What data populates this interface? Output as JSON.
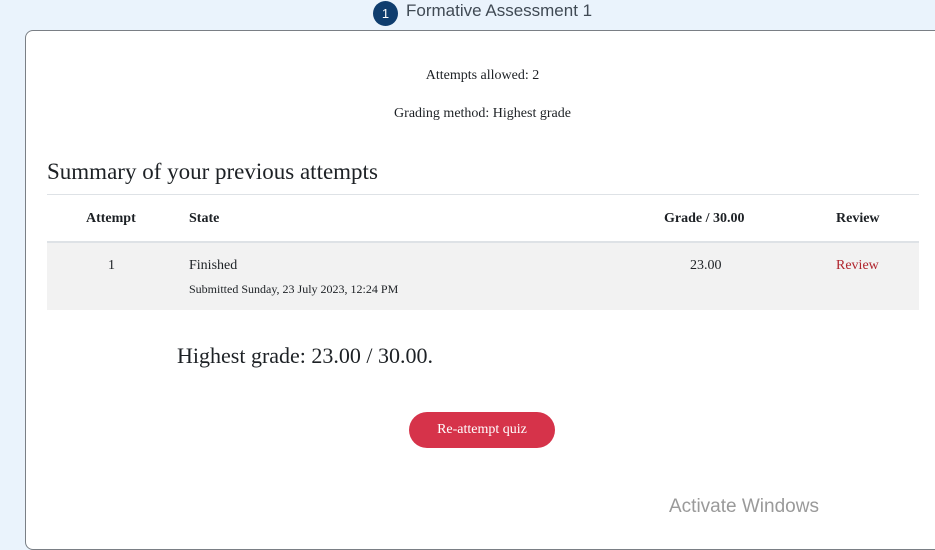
{
  "step": {
    "number": "1",
    "title": "Formative Assessment 1"
  },
  "quiz_info": {
    "attempts_allowed": "Attempts allowed: 2",
    "grading_method": "Grading method: Highest grade"
  },
  "summary": {
    "title": "Summary of your previous attempts",
    "columns": [
      "Attempt",
      "State",
      "Grade / 30.00",
      "Review"
    ],
    "rows": [
      {
        "attempt": "1",
        "state": "Finished",
        "submitted": "Submitted Sunday, 23 July 2023, 12:24 PM",
        "grade": "23.00",
        "review": "Review"
      }
    ]
  },
  "highest_grade": "Highest grade: 23.00 / 30.00.",
  "actions": {
    "reattempt_label": "Re-attempt quiz"
  },
  "watermark": "Activate Windows",
  "colors": {
    "step_badge": "#0f3d6e",
    "button": "#d6334a",
    "review_link": "#b0242d",
    "row_background": "#f2f2f2"
  }
}
